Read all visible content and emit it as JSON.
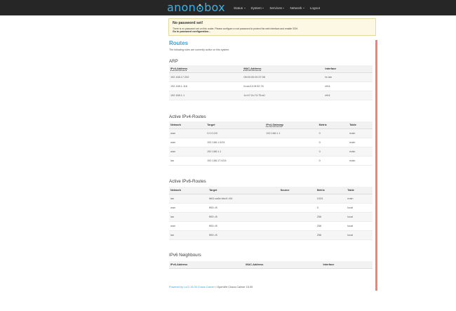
{
  "brand": {
    "left": "anon",
    "right": "box"
  },
  "nav": {
    "items": [
      {
        "label": "Status",
        "dropdown": true
      },
      {
        "label": "System",
        "dropdown": true
      },
      {
        "label": "Services",
        "dropdown": true
      },
      {
        "label": "Network",
        "dropdown": true
      },
      {
        "label": "Logout",
        "dropdown": false
      }
    ]
  },
  "alert": {
    "title": "No password set!",
    "text": "There is no password set on this router. Please configure a root password to protect the web interface and enable SSH.",
    "link": "Go to password configuration..."
  },
  "page": {
    "title": "Routes",
    "description": "The following rules are currently active on this system."
  },
  "arp": {
    "title": "ARP",
    "headers": [
      "IPv4-Address",
      "MAC-Address",
      "Interface"
    ],
    "rows": [
      [
        "192.168.17.202",
        "08:00:00:00:37:06",
        "br-lan"
      ],
      [
        "192.168.1.116",
        "fc:aa:14:3f:32:7b",
        "eth1"
      ],
      [
        "192.168.1.1",
        "1c:b7:2c:74:75:a0",
        "eth1"
      ]
    ]
  },
  "ipv4": {
    "title": "Active IPv4-Routes",
    "headers": [
      "Network",
      "Target",
      "IPv4-Gateway",
      "Metric",
      "Table"
    ],
    "rows": [
      [
        "wan",
        "0.0.0.0/0",
        "192.168.1.1",
        "0",
        "main"
      ],
      [
        "wan",
        "192.168.1.0/24",
        "",
        "0",
        "main"
      ],
      [
        "wan",
        "192.168.1.1",
        "",
        "0",
        "main"
      ],
      [
        "lan",
        "192.168.17.0/24",
        "",
        "0",
        "main"
      ]
    ]
  },
  "ipv6": {
    "title": "Active IPv6-Routes",
    "headers": [
      "Network",
      "Target",
      "Source",
      "Metric",
      "Table"
    ],
    "rows": [
      [
        "lan",
        "fd61:ca6e:bbc0::/64",
        "",
        "1024",
        "main"
      ],
      [
        "wan",
        "ff00::/8",
        "",
        "0",
        "local"
      ],
      [
        "lan",
        "ff00::/8",
        "",
        "256",
        "local"
      ],
      [
        "wan",
        "ff00::/8",
        "",
        "256",
        "local"
      ],
      [
        "lan",
        "ff00::/8",
        "",
        "256",
        "local"
      ]
    ]
  },
  "neighbours": {
    "title": "IPv6 Neighbours",
    "headers": [
      "IPv6-Address",
      "MAC-Address",
      "Interface"
    ]
  },
  "footer": {
    "link": "Powered by LuCI 15.05 Chaos Calmer",
    "text": "OpenWrt Chaos Calmer 15.05"
  },
  "colors": {
    "accent": "#3fa0d6",
    "topbar": "#262626",
    "alert_bg": "#fcf8e3",
    "side_accent": "#e8857a"
  }
}
